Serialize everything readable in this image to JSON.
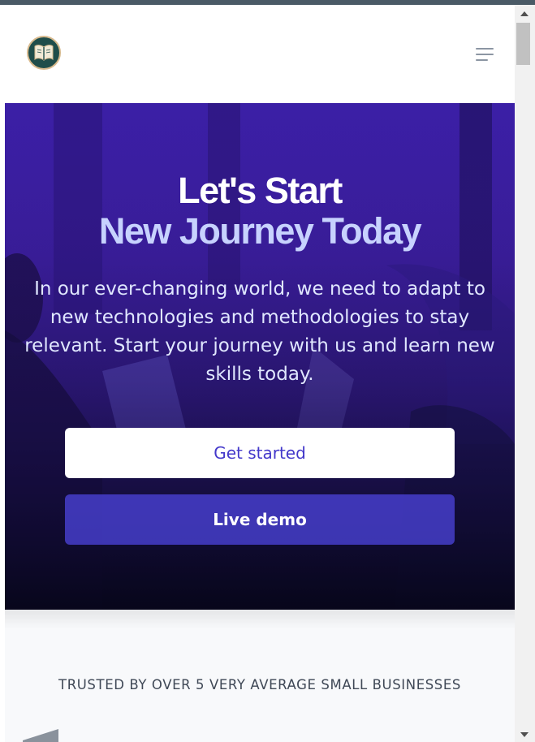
{
  "header": {
    "logo_icon": "open-book-icon",
    "menu_icon": "hamburger-menu-icon"
  },
  "hero": {
    "title_line1": "Let's Start",
    "title_line2": "New Journey Today",
    "description_lines": [
      "In our ever-changing world, we need to adapt to",
      "new technologies and methodologies to stay",
      "relevant. Start your journey with us and learn new",
      "skills today."
    ],
    "primary_button": "Get started",
    "secondary_button": "Live demo"
  },
  "trusted": {
    "text": "TRUSTED BY OVER 5 VERY AVERAGE SMALL BUSINESSES"
  },
  "colors": {
    "accent": "#4338ca",
    "title_highlight": "#c7d2fe",
    "hero_overlay": "#3b1fa6"
  }
}
